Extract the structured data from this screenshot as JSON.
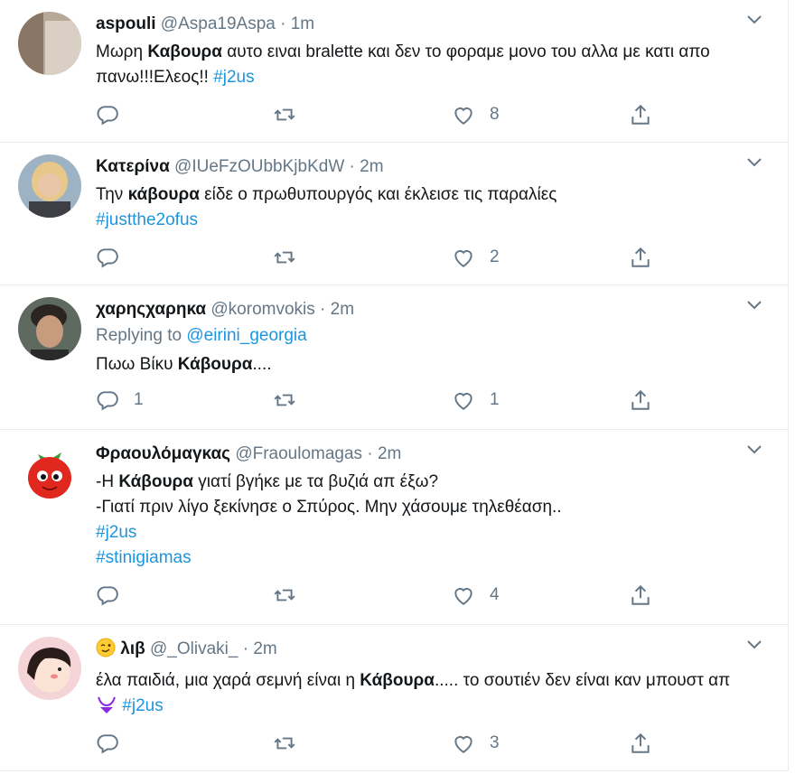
{
  "tweets": [
    {
      "name": "aspouli",
      "handle": "@Aspa19Aspa",
      "time": "1m",
      "text_1": "Μωρη ",
      "bold": "Καβουρα",
      "text_2": " αυτο ειναι bralette και δεν το φοραμε μονο του αλλα με κατι απο πανω!!!Ελεος!! ",
      "hashtag": "#j2us",
      "replies": "",
      "likes": "8"
    },
    {
      "name": "Κατερίνα",
      "handle": "@IUeFzOUbbKjbKdW",
      "time": "2m",
      "text_1": "Την ",
      "bold": "κάβουρα",
      "text_2": " είδε ο πρωθυπουργός και έκλεισε τις παραλίες",
      "hashtag": "#justthe2ofus",
      "replies": "",
      "likes": "2"
    },
    {
      "name": "χαρηςχαρηκα",
      "handle": "@koromvokis",
      "time": "2m",
      "replying_label": "Replying to",
      "replying_to": "@eirini_georgia",
      "text_1": "Πωω Βίκυ ",
      "bold": "Κάβουρα",
      "text_2": "....",
      "replies": "1",
      "likes": "1"
    },
    {
      "name": "Φραουλόμαγκας",
      "handle": "@Fraoulomagas",
      "time": "2m",
      "text_1": "-Η ",
      "bold": "Κάβουρα",
      "text_2": " γιατί βγήκε με τα βυζιά απ έξω?",
      "line_2": "-Γιατί πριν λίγο ξεκίνησε ο Σπύρος. Μην χάσουμε τηλεθέαση..",
      "hashtag": "#j2us",
      "hashtag_2": "#stinigiamas",
      "replies": "",
      "likes": "4"
    },
    {
      "name_emoji": "winking-face-emoji",
      "name": "λιβ",
      "handle": "@_Olivaki_",
      "time": "2m",
      "text_1": "έλα παιδιά, μια χαρά σεμνή είναι η ",
      "bold": "Κάβουρα",
      "text_2": "..... το σουτιέν δεν είναι καν μπουστ απ ",
      "text_emoji": "bikini-emoji",
      "hashtag": "#j2us",
      "replies": "",
      "likes": "3"
    }
  ],
  "colors": {
    "link": "#1b95e0",
    "muted": "#657786",
    "text": "#14171a",
    "border": "#e6ecf0"
  },
  "dot": "·"
}
